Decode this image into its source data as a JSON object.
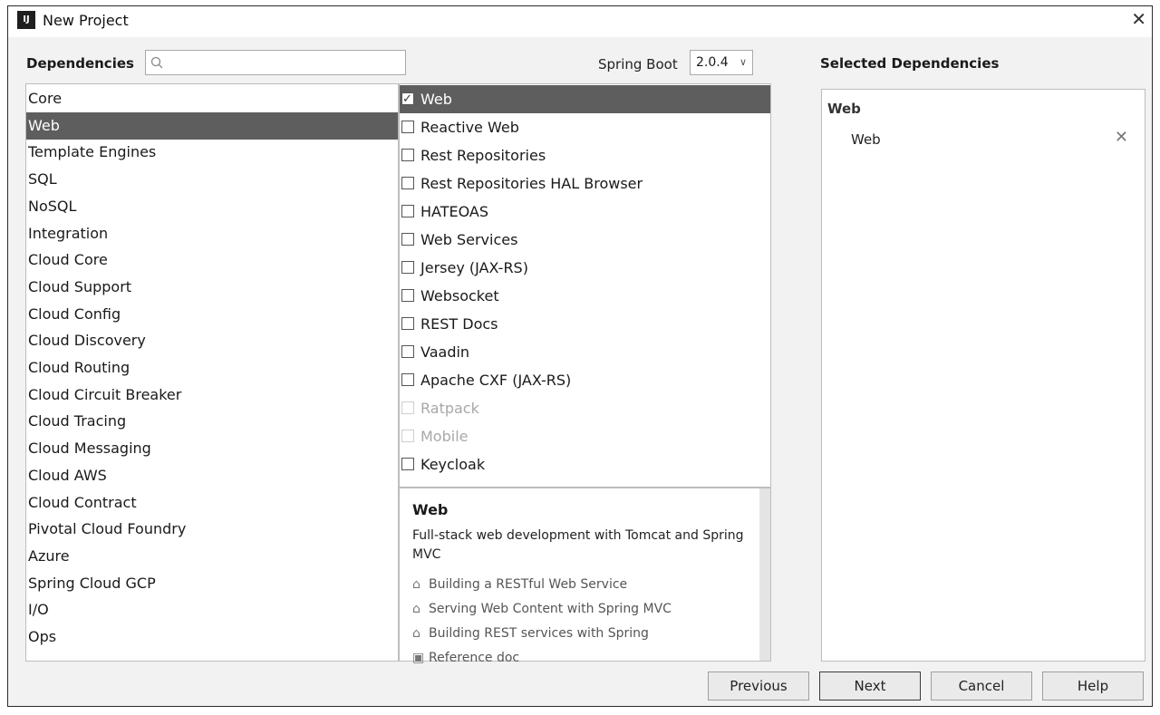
{
  "window": {
    "title": "New Project",
    "icon_text": "IJ"
  },
  "header": {
    "dependencies_label": "Dependencies",
    "search_value": "",
    "spring_boot_label": "Spring Boot",
    "spring_boot_version": "2.0.4",
    "selected_label": "Selected Dependencies"
  },
  "categories": [
    {
      "label": "Core"
    },
    {
      "label": "Web",
      "selected": true
    },
    {
      "label": "Template Engines"
    },
    {
      "label": "SQL"
    },
    {
      "label": "NoSQL"
    },
    {
      "label": "Integration"
    },
    {
      "label": "Cloud Core"
    },
    {
      "label": "Cloud Support"
    },
    {
      "label": "Cloud Config"
    },
    {
      "label": "Cloud Discovery"
    },
    {
      "label": "Cloud Routing"
    },
    {
      "label": "Cloud Circuit Breaker"
    },
    {
      "label": "Cloud Tracing"
    },
    {
      "label": "Cloud Messaging"
    },
    {
      "label": "Cloud AWS"
    },
    {
      "label": "Cloud Contract"
    },
    {
      "label": "Pivotal Cloud Foundry"
    },
    {
      "label": "Azure"
    },
    {
      "label": "Spring Cloud GCP"
    },
    {
      "label": "I/O"
    },
    {
      "label": "Ops"
    }
  ],
  "dependencies": [
    {
      "label": "Web",
      "checked": true,
      "selected": true
    },
    {
      "label": "Reactive Web",
      "checked": false
    },
    {
      "label": "Rest Repositories",
      "checked": false
    },
    {
      "label": "Rest Repositories HAL Browser",
      "checked": false
    },
    {
      "label": "HATEOAS",
      "checked": false
    },
    {
      "label": "Web Services",
      "checked": false
    },
    {
      "label": "Jersey (JAX-RS)",
      "checked": false
    },
    {
      "label": "Websocket",
      "checked": false
    },
    {
      "label": "REST Docs",
      "checked": false
    },
    {
      "label": "Vaadin",
      "checked": false
    },
    {
      "label": "Apache CXF (JAX-RS)",
      "checked": false
    },
    {
      "label": "Ratpack",
      "checked": false,
      "disabled": true
    },
    {
      "label": "Mobile",
      "checked": false,
      "disabled": true
    },
    {
      "label": "Keycloak",
      "checked": false
    }
  ],
  "description": {
    "title": "Web",
    "text": "Full-stack web development with Tomcat and Spring MVC",
    "guides": [
      {
        "label": "Building a RESTful Web Service",
        "icon": "home-icon"
      },
      {
        "label": "Serving Web Content with Spring MVC",
        "icon": "home-icon"
      },
      {
        "label": "Building REST services with Spring",
        "icon": "home-icon"
      },
      {
        "label": "Reference doc",
        "icon": "reference-doc-icon"
      }
    ]
  },
  "selected": {
    "group": "Web",
    "items": [
      "Web"
    ]
  },
  "buttons": {
    "previous": "Previous",
    "next": "Next",
    "cancel": "Cancel",
    "help": "Help"
  }
}
